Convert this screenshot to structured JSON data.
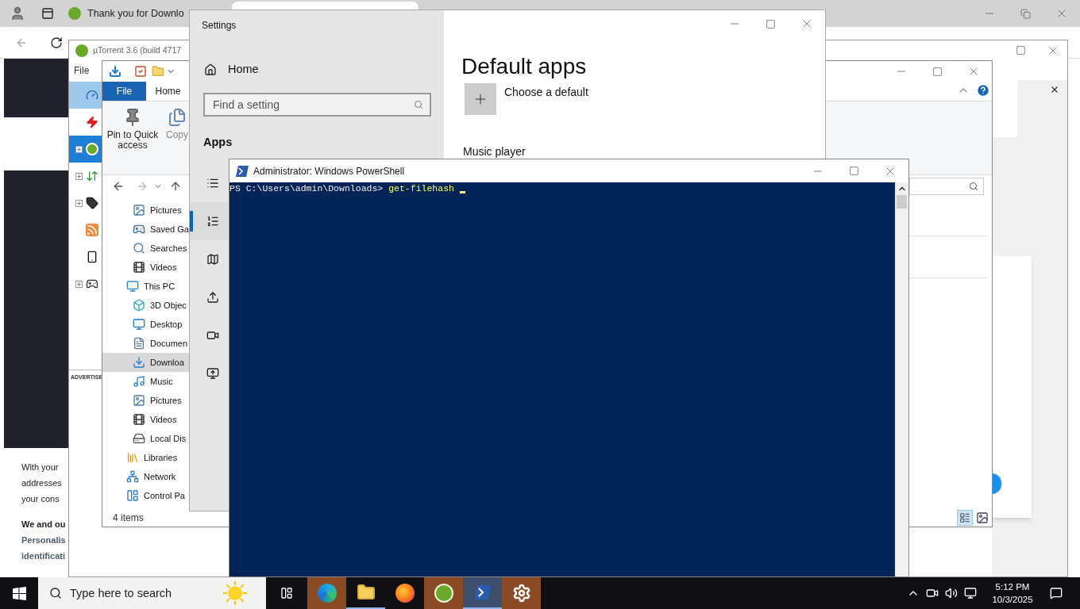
{
  "browser": {
    "tab_title": "Thank you for Downlo",
    "page": {
      "advert_label": "ADVERTISE",
      "paragraph_lines": [
        "With your",
        "addresses",
        "your cons"
      ],
      "bold_line": "We and ou",
      "link_lines": [
        "Personalis",
        "identificati"
      ]
    }
  },
  "utorrent": {
    "title": "µTorrent 3.6 (build 4717",
    "menu": [
      "File"
    ],
    "sidebar": [
      {
        "kind": "speed",
        "expandable": false,
        "selected": false,
        "highlighted": true
      },
      {
        "kind": "bolt",
        "expandable": false,
        "selected": false,
        "highlighted": false
      },
      {
        "kind": "logo",
        "expandable": true,
        "selected": true,
        "highlighted": false
      },
      {
        "kind": "transfer",
        "expandable": true,
        "selected": false,
        "highlighted": false
      },
      {
        "kind": "tag",
        "expandable": true,
        "selected": false,
        "highlighted": false
      },
      {
        "kind": "feed",
        "expandable": false,
        "selected": false,
        "highlighted": false
      },
      {
        "kind": "device",
        "expandable": false,
        "selected": false,
        "highlighted": false
      },
      {
        "kind": "game",
        "expandable": true,
        "selected": false,
        "highlighted": false
      }
    ]
  },
  "explorer": {
    "ribbon_tabs": [
      {
        "label": "File",
        "kind": "menu"
      },
      {
        "label": "Home",
        "kind": "tab"
      }
    ],
    "ribbon_buttons": [
      "Pin to Quick access",
      "Copy"
    ],
    "nav_tree": {
      "continued_children": [
        {
          "label": "Pictures",
          "selected": false
        },
        {
          "label": "Saved Ga",
          "selected": false
        },
        {
          "label": "Searches",
          "selected": false
        },
        {
          "label": "Videos",
          "selected": false
        }
      ],
      "items": [
        {
          "label": "This PC",
          "selected": false,
          "children": [
            {
              "label": "3D Objec",
              "selected": false
            },
            {
              "label": "Desktop",
              "selected": false
            },
            {
              "label": "Documen",
              "selected": false
            },
            {
              "label": "Downloa",
              "selected": true
            },
            {
              "label": "Music",
              "selected": false
            },
            {
              "label": "Pictures",
              "selected": false
            },
            {
              "label": "Videos",
              "selected": false
            },
            {
              "label": "Local Dis",
              "selected": false
            }
          ]
        },
        {
          "label": "Libraries",
          "selected": false
        },
        {
          "label": "Network",
          "selected": false
        },
        {
          "label": "Control Pa",
          "selected": false
        }
      ]
    },
    "status": "4 items"
  },
  "settings": {
    "title": "Settings",
    "home": "Home",
    "search": {
      "placeholder": "Find a setting"
    },
    "section": "Apps",
    "nav": [
      {
        "selected": false
      },
      {
        "selected": true
      },
      {
        "selected": false
      },
      {
        "selected": false
      },
      {
        "selected": false
      },
      {
        "selected": false
      }
    ],
    "page_title": "Default apps",
    "choose_label": "Choose a default",
    "group_label": "Music player"
  },
  "powershell": {
    "title": "Administrator: Windows PowerShell",
    "prompt": "PS C:\\Users\\admin\\Downloads> ",
    "command": "get-filehash"
  },
  "taskbar": {
    "search_placeholder": "Type here to search",
    "apps": [
      {
        "kind": "edge",
        "flashing": true,
        "active": false,
        "open": false
      },
      {
        "kind": "files",
        "flashing": false,
        "active": false,
        "open": true
      },
      {
        "kind": "firefox",
        "flashing": false,
        "active": false,
        "open": false
      },
      {
        "kind": "torrent",
        "flashing": true,
        "active": false,
        "open": false
      },
      {
        "kind": "shell",
        "flashing": false,
        "active": true,
        "open": true
      },
      {
        "kind": "gear",
        "flashing": true,
        "active": false,
        "open": false
      }
    ],
    "time": "5:12 PM",
    "date": "10/3/2025"
  }
}
